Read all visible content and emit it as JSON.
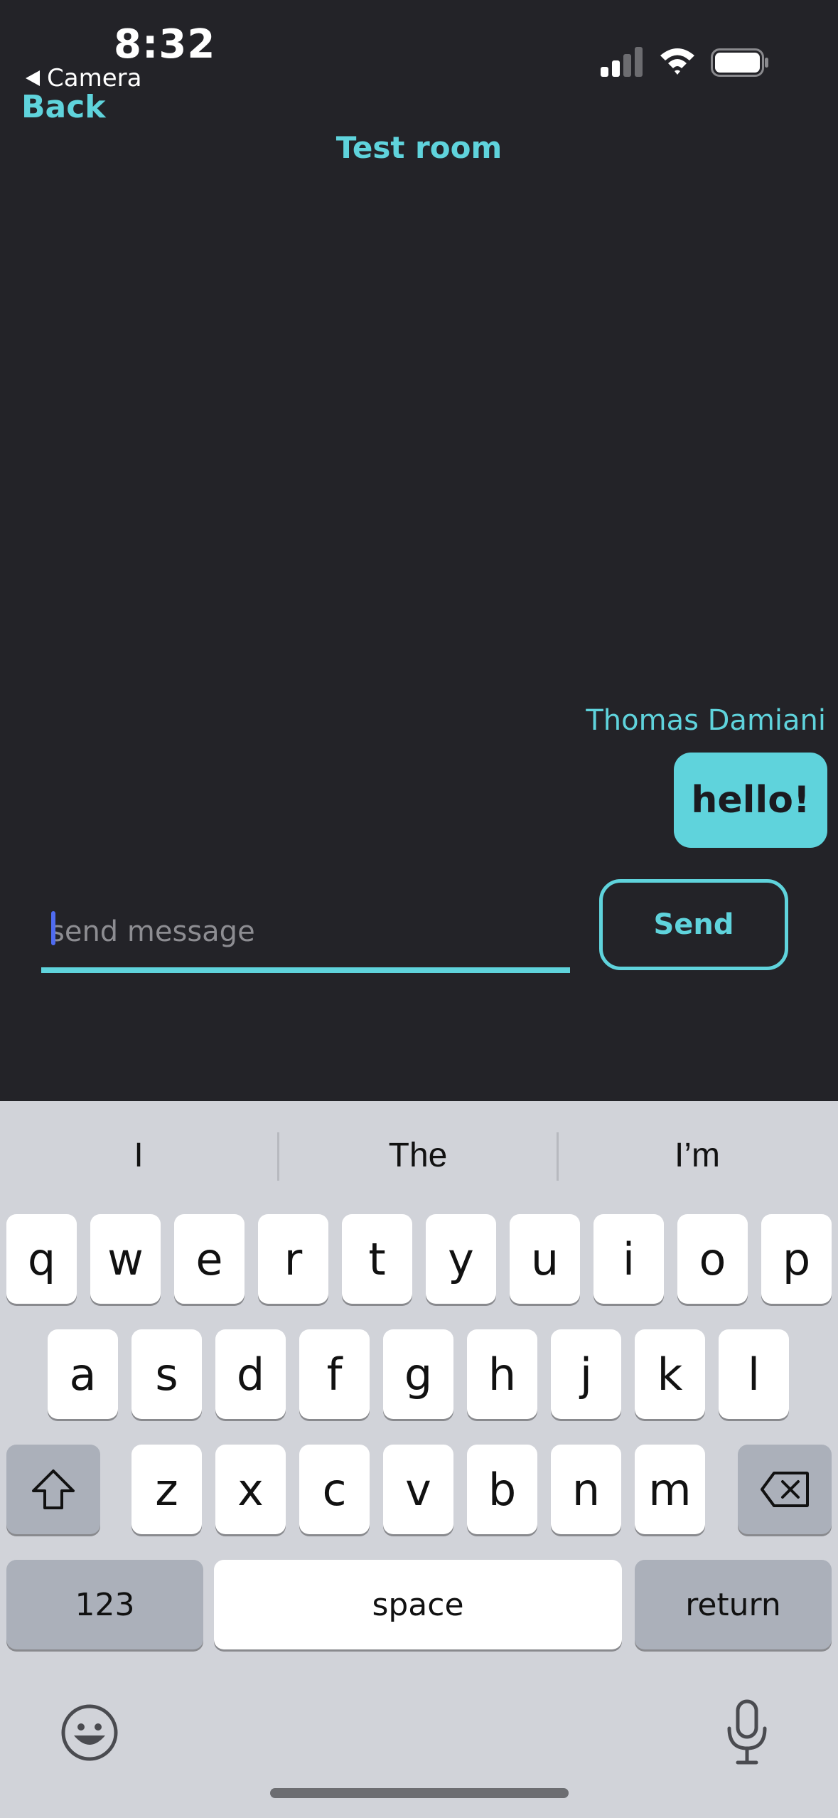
{
  "status_bar": {
    "time": "8:32",
    "back_app": "Camera"
  },
  "header": {
    "back_label": "Back",
    "title": "Test room"
  },
  "messages": [
    {
      "sender": "Thomas Damiani",
      "text": "hello!"
    }
  ],
  "composer": {
    "placeholder": "send message",
    "value": "",
    "send_label": "Send"
  },
  "keyboard": {
    "suggestions": [
      "I",
      "The",
      "I’m"
    ],
    "row1": [
      "q",
      "w",
      "e",
      "r",
      "t",
      "y",
      "u",
      "i",
      "o",
      "p"
    ],
    "row2": [
      "a",
      "s",
      "d",
      "f",
      "g",
      "h",
      "j",
      "k",
      "l"
    ],
    "row3": [
      "z",
      "x",
      "c",
      "v",
      "b",
      "n",
      "m"
    ],
    "numbers_label": "123",
    "space_label": "space",
    "return_label": "return"
  },
  "colors": {
    "accent": "#5fd3dc",
    "background": "#232328",
    "keyboard": "#d1d3d9"
  }
}
